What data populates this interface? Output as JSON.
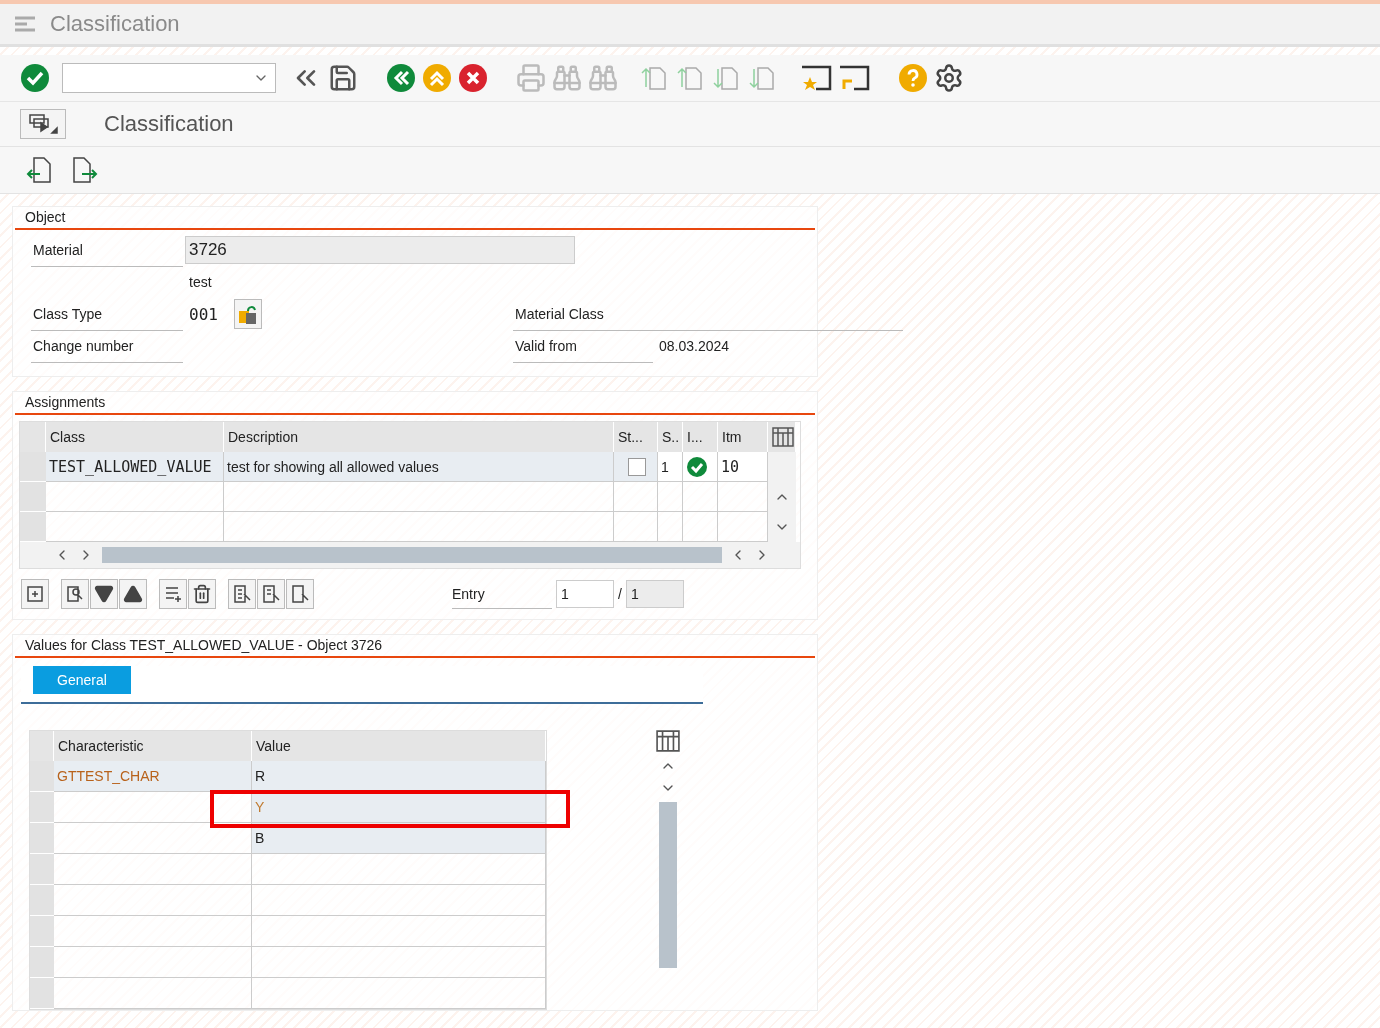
{
  "window": {
    "title": "Classification"
  },
  "screen_title": "Classification",
  "object": {
    "title": "Object",
    "material_label": "Material",
    "material_value": "3726",
    "material_description": "test",
    "class_type_label": "Class Type",
    "class_type_value": "001",
    "material_class_label": "Material Class",
    "change_number_label": "Change number",
    "valid_from_label": "Valid from",
    "valid_from_value": "08.03.2024"
  },
  "assignments": {
    "title": "Assignments",
    "columns": [
      "Class",
      "Description",
      "St...",
      "S..",
      "I...",
      "Itm"
    ],
    "rows": [
      {
        "class": "TEST_ALLOWED_VALUE",
        "description": "test for showing all allowed values",
        "status_checked": false,
        "s": "1",
        "ok": true,
        "item": "10"
      }
    ],
    "entry_label": "Entry",
    "entry_value": "1",
    "entry_separator": "/",
    "entry_total": "1"
  },
  "values": {
    "title": "Values for Class TEST_ALLOWED_VALUE - Object 3726",
    "tabs": [
      {
        "label": "General",
        "selected": true
      }
    ],
    "columns": [
      "Characteristic",
      "Value"
    ],
    "rows": [
      {
        "characteristic": "GTTEST_CHAR",
        "value": "R",
        "marked": false
      },
      {
        "value": "Y",
        "marked": true
      },
      {
        "value": "B",
        "marked": false
      }
    ]
  }
}
